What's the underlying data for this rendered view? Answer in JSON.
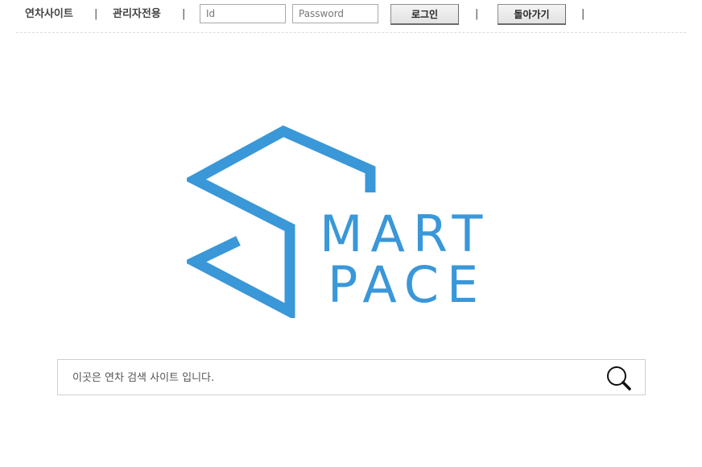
{
  "topbar": {
    "site_link": "연차사이트",
    "admin_link": "관리자전용",
    "separator": "|",
    "id_placeholder": "Id",
    "password_placeholder": "Password",
    "login_label": "로그인",
    "back_label": "돌아가기"
  },
  "logo": {
    "line1": "MART",
    "line2": "PACE",
    "color": "#3a97d8"
  },
  "search": {
    "placeholder": "이곳은 연차 검색 사이트 입니다.",
    "icon": "search-icon"
  }
}
